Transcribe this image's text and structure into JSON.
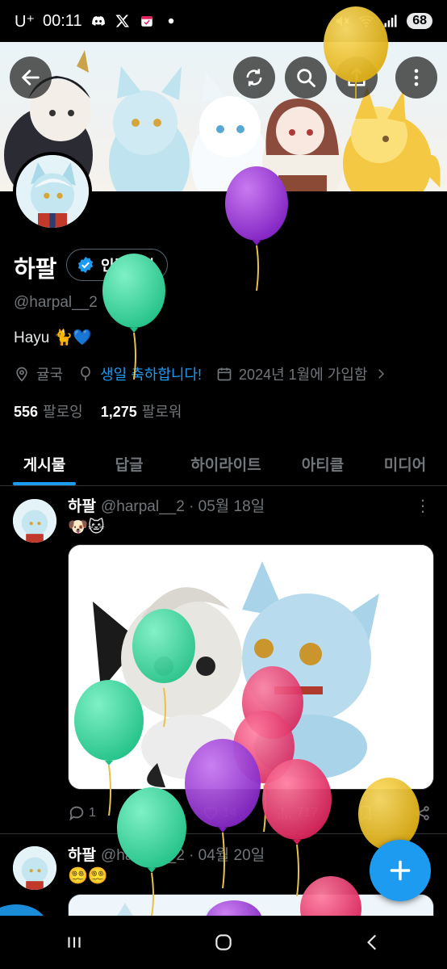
{
  "status_bar": {
    "carrier": "U⁺",
    "time": "00:11",
    "battery": "68"
  },
  "header": {
    "back_icon": "arrow-left-icon",
    "actions": [
      "refresh-icon",
      "search-icon",
      "share-icon",
      "more-vertical-icon"
    ]
  },
  "profile": {
    "name": "하팔",
    "verify_label": "인증받기",
    "handle": "@harpal__2",
    "bio": "Hayu 🐈💙",
    "location": "귤국",
    "birthday": "생일 축하합니다!",
    "joined": "2024년 1월에 가입함",
    "following_count": "556",
    "following_label": "팔로잉",
    "followers_count": "1,275",
    "followers_label": "팔로워"
  },
  "tabs": [
    "게시물",
    "답글",
    "하이라이트",
    "아티클",
    "미디어"
  ],
  "active_tab": "게시물",
  "posts": [
    {
      "name": "하팔",
      "handle": "@harpal__2",
      "date": "· 05월 18일",
      "text": "🐶🐱",
      "replies": "1",
      "reposts": "5",
      "likes": "14",
      "views": "717"
    },
    {
      "name": "하팔",
      "handle": "@harpal__2",
      "date": "· 04월 20일",
      "text": "😵‍💫😵‍💫"
    }
  ],
  "fab": {
    "icon": "plus-icon"
  },
  "navbar": [
    "recent-apps-icon",
    "home-icon",
    "back-icon"
  ],
  "colors": {
    "accent": "#1d9bf0",
    "balloon_green": "#2fd69b",
    "balloon_purple": "#9b2fd6",
    "balloon_pink": "#ea2f6b",
    "balloon_yellow": "#e8bd1c"
  }
}
